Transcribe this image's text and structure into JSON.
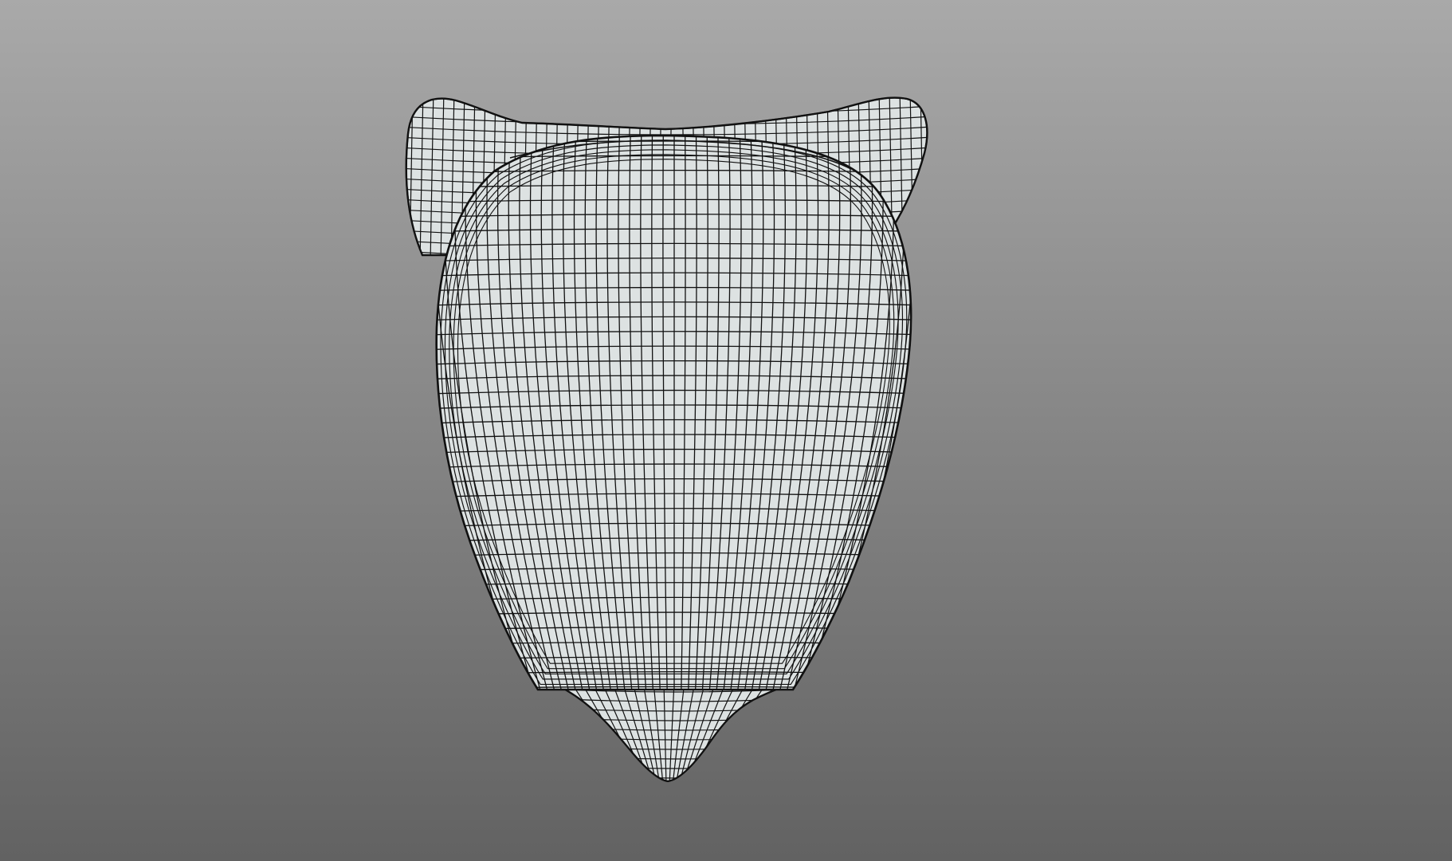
{
  "viewport": {
    "background_top": "#a9a9a9",
    "background_bottom": "#626262"
  },
  "mesh": {
    "object": "head-mesh",
    "display_mode": "wireframe-on-shaded",
    "surface_color": "#dde2e2",
    "wire_color": "#111111"
  }
}
